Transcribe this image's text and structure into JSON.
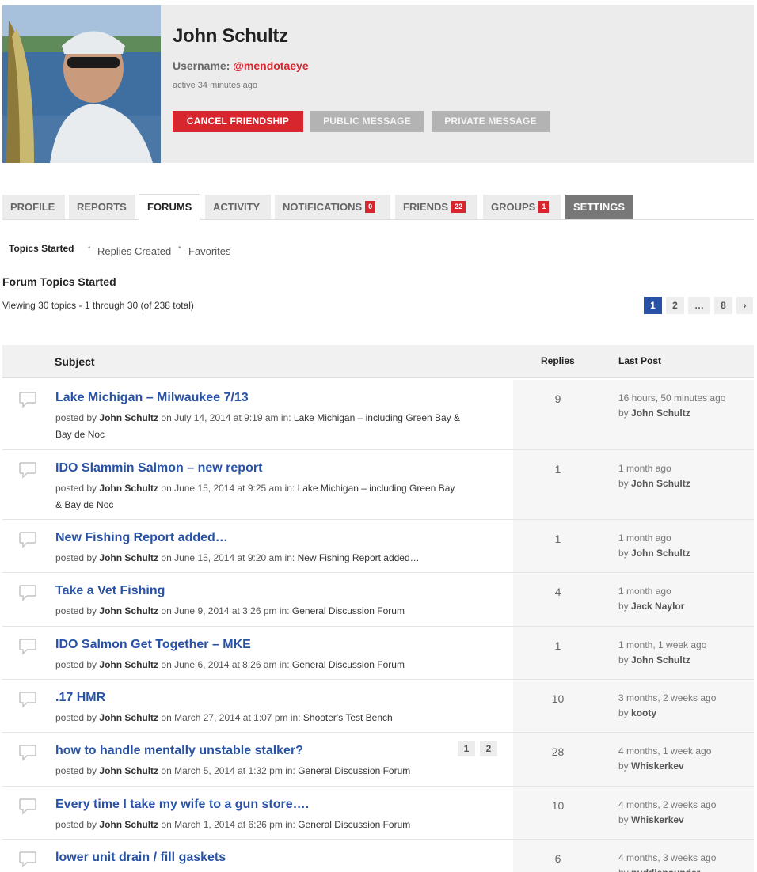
{
  "profile": {
    "name": "John Schultz",
    "username_label": "Username:",
    "username": "@mendotaeye",
    "active": "active 34 minutes ago",
    "buttons": {
      "cancel": "CANCEL FRIENDSHIP",
      "public": "PUBLIC MESSAGE",
      "private": "PRIVATE MESSAGE"
    }
  },
  "tabs": [
    {
      "label": "PROFILE"
    },
    {
      "label": "REPORTS"
    },
    {
      "label": "FORUMS"
    },
    {
      "label": "ACTIVITY"
    },
    {
      "label": "NOTIFICATIONS",
      "count": "0"
    },
    {
      "label": "FRIENDS",
      "count": "22"
    },
    {
      "label": "GROUPS",
      "count": "1"
    },
    {
      "label": "SETTINGS"
    }
  ],
  "subnav": {
    "topics": "Topics Started",
    "sep1": "•",
    "replies": "Replies Created",
    "sep2": "•",
    "favorites": "Favorites"
  },
  "section_title": "Forum Topics Started",
  "viewing": "Viewing 30 topics - 1 through 30 (of 238 total)",
  "pagination": [
    "1",
    "2",
    "…",
    "8",
    "›"
  ],
  "table": {
    "headers": {
      "subject": "Subject",
      "replies": "Replies",
      "last_post": "Last Post"
    },
    "posted_by": "posted by",
    "in_label": "in:",
    "rows": [
      {
        "title": "Lake Michigan – Milwaukee 7/13",
        "author": "John Schultz",
        "date": "on July 14, 2014 at 9:19 am",
        "forum": "Lake Michigan – including Green Bay &",
        "forum2": "Bay de Noc",
        "replies": "9",
        "last_time": "16 hours, 50 minutes ago",
        "by_label": "by",
        "last_by": "John Schultz"
      },
      {
        "title": "IDO Slammin Salmon – new report",
        "author": "John Schultz",
        "date": "on June 15, 2014 at 9:25 am",
        "forum": "Lake Michigan – including Green Bay",
        "forum2": "& Bay de Noc",
        "replies": "1",
        "last_time": "1 month ago",
        "by_label": "by",
        "last_by": "John Schultz"
      },
      {
        "title": "New Fishing Report added…",
        "author": "John Schultz",
        "date": "on June 15, 2014 at 9:20 am",
        "forum": "New Fishing Report added…",
        "replies": "1",
        "last_time": "1 month ago",
        "by_label": "by",
        "last_by": "John Schultz"
      },
      {
        "title": "Take a Vet Fishing",
        "author": "John Schultz",
        "date": "on June 9, 2014 at 3:26 pm",
        "forum": "General Discussion Forum",
        "replies": "4",
        "last_time": "1 month ago",
        "by_label": "by",
        "last_by": "Jack Naylor"
      },
      {
        "title": "IDO Salmon Get Together – MKE",
        "author": "John Schultz",
        "date": "on June 6, 2014 at 8:26 am",
        "forum": "General Discussion Forum",
        "replies": "1",
        "last_time": "1 month, 1 week ago",
        "by_label": "by",
        "last_by": "John Schultz"
      },
      {
        "title": ".17 HMR",
        "author": "John Schultz",
        "date": "on March 27, 2014 at 1:07 pm",
        "forum": "Shooter's Test Bench",
        "replies": "10",
        "last_time": "3 months, 2 weeks ago",
        "by_label": "by",
        "last_by": "kooty"
      },
      {
        "title": "how to handle mentally unstable stalker?",
        "author": "John Schultz",
        "date": "on March 5, 2014 at 1:32 pm",
        "forum": "General Discussion Forum",
        "replies": "28",
        "last_time": "4 months, 1 week ago",
        "by_label": "by",
        "last_by": "Whiskerkev",
        "pages": [
          "1",
          "2"
        ]
      },
      {
        "title": "Every time I take my wife to a gun store….",
        "author": "John Schultz",
        "date": "on March 1, 2014 at 6:26 pm",
        "forum": "General Discussion Forum",
        "replies": "10",
        "last_time": "4 months, 2 weeks ago",
        "by_label": "by",
        "last_by": "Whiskerkev"
      },
      {
        "title": "lower unit drain / fill gaskets",
        "replies": "6",
        "last_time": "4 months, 3 weeks ago",
        "by_label": "by",
        "last_by": "puddlepounder"
      }
    ]
  },
  "colors": {
    "accent_red": "#d8262e",
    "link_blue": "#2852a5",
    "tab_gray": "#ececec"
  },
  "icons": [
    "speech-bubble-icon",
    "chevron-right-icon"
  ]
}
